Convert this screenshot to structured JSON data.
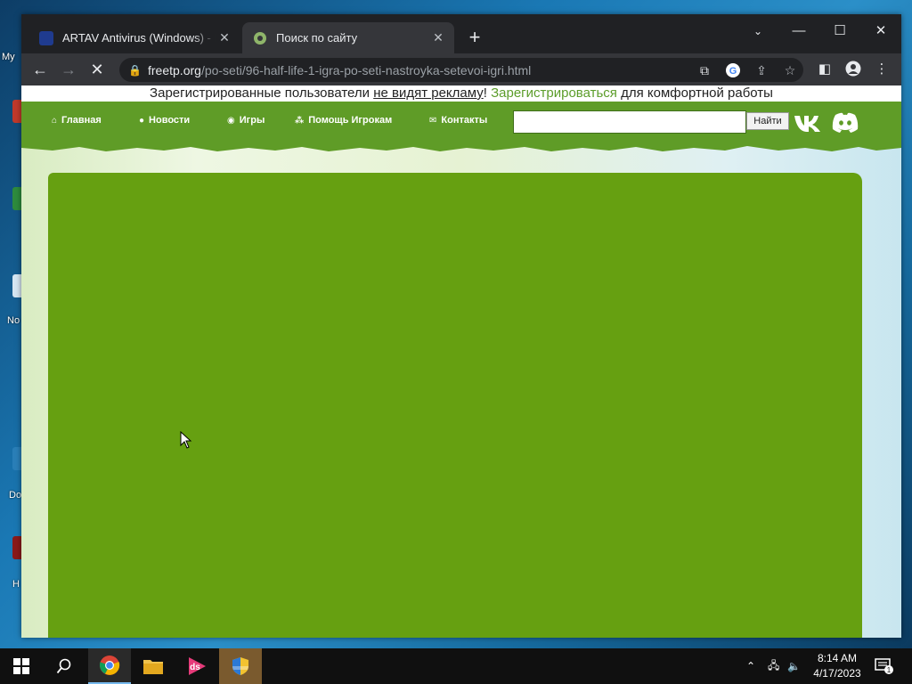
{
  "browser": {
    "tabs": [
      {
        "title": "ARTAV Antivirus (Windows) - Dov",
        "active": false
      },
      {
        "title": "Поиск по сайту",
        "active": true
      }
    ],
    "url_host": "freetp.org",
    "url_path": "/po-seti/96-half-life-1-igra-po-seti-nastroyka-setevoi-igri.html"
  },
  "promo": {
    "text_before": "Зарегистрированные пользователи ",
    "link_text": "не видят рекламу",
    "text_mid": "! ",
    "register_text": "Зарегистрироваться",
    "text_after": " для комфортной работы"
  },
  "site_nav": {
    "items": [
      {
        "label": "Главная",
        "icon": "home-icon"
      },
      {
        "label": "Новости",
        "icon": "comments-icon"
      },
      {
        "label": "Игры",
        "icon": "play-circle-icon"
      },
      {
        "label": "Помощь Игрокам",
        "icon": "sitemap-icon"
      },
      {
        "label": "Контакты",
        "icon": "envelope-icon"
      }
    ],
    "search_placeholder": "",
    "search_button": "Найти"
  },
  "desktop": {
    "icon_labels": [
      "My",
      "N",
      "No",
      "Do",
      "H"
    ]
  },
  "taskbar": {
    "time": "8:14 AM",
    "date": "4/17/2023",
    "notification_count": "1"
  },
  "colors": {
    "nav_green": "#5f9c27",
    "content_green": "#66a011",
    "register_green": "#5c9d2a"
  }
}
